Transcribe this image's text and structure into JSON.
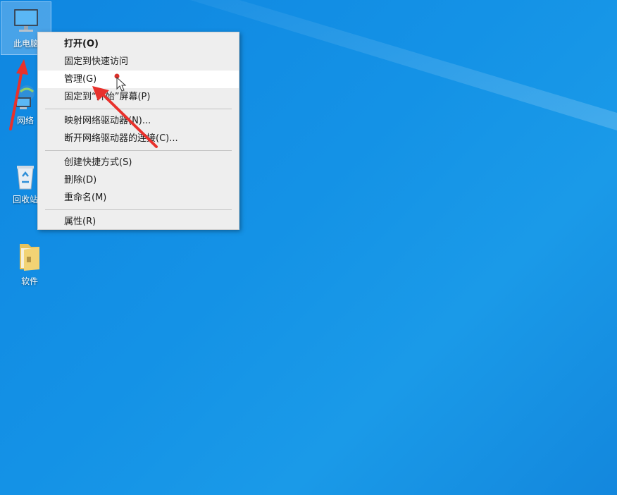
{
  "desktop": {
    "icons": [
      {
        "label": "此电脑",
        "icon": "computer-icon"
      },
      {
        "label": "网络",
        "icon": "network-icon"
      },
      {
        "label": "回收站",
        "icon": "recycle-bin-icon"
      },
      {
        "label": "软件",
        "icon": "folder-icon"
      }
    ]
  },
  "context_menu": {
    "groups": [
      [
        {
          "label": "打开(O)",
          "bold": true
        },
        {
          "label": "固定到快速访问"
        },
        {
          "label": "管理(G)",
          "hover": true
        },
        {
          "label": "固定到“开始”屏幕(P)"
        }
      ],
      [
        {
          "label": "映射网络驱动器(N)..."
        },
        {
          "label": "断开网络驱动器的连接(C)..."
        }
      ],
      [
        {
          "label": "创建快捷方式(S)"
        },
        {
          "label": "删除(D)"
        },
        {
          "label": "重命名(M)"
        }
      ],
      [
        {
          "label": "属性(R)"
        }
      ]
    ]
  },
  "colors": {
    "desktop_blue": "#1492e6",
    "menu_bg": "#eeeeee",
    "menu_hover": "#ffffff",
    "annotation_arrow": "#e8312c"
  }
}
